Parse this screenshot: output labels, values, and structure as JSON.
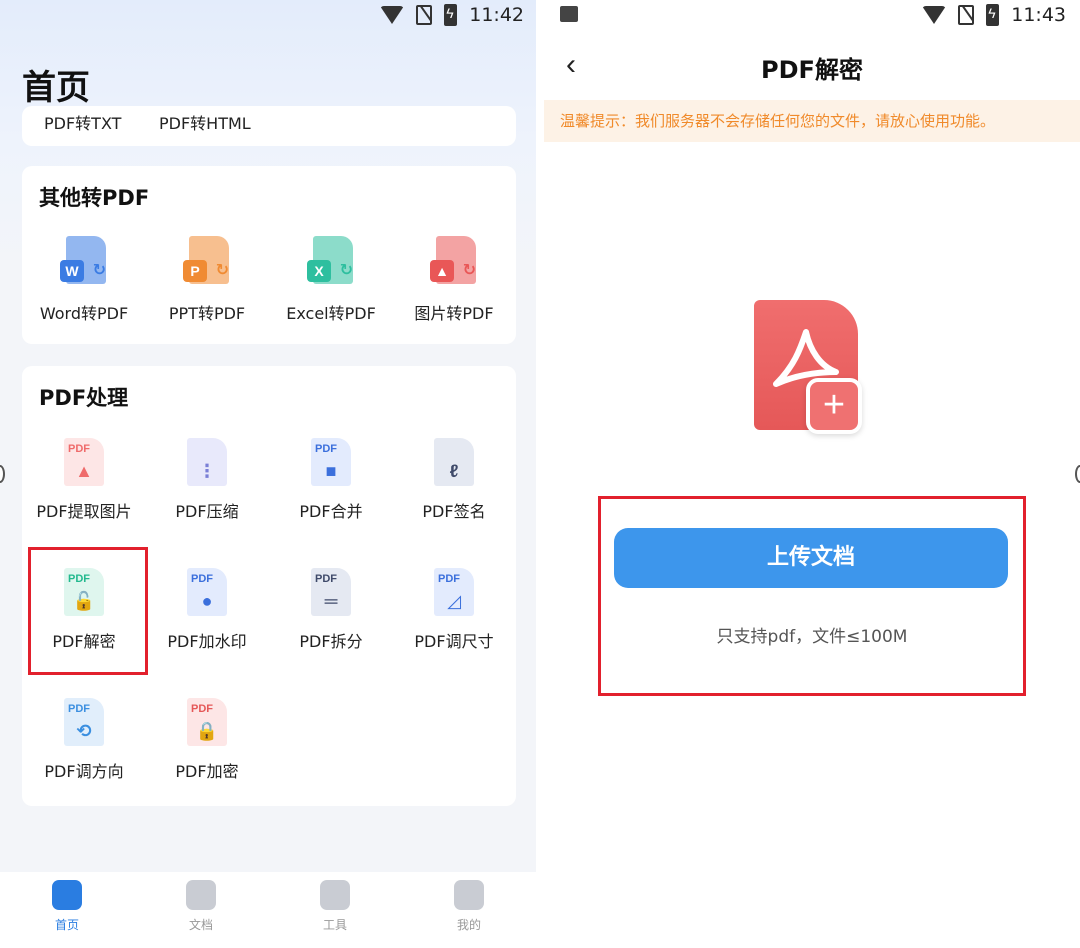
{
  "left": {
    "status": {
      "time": "11:42"
    },
    "page_title": "首页",
    "top_links": [
      "PDF转TXT",
      "PDF转HTML"
    ],
    "other_to_pdf": {
      "heading": "其他转PDF",
      "items": [
        {
          "label": "Word转PDF",
          "icon": "word-icon",
          "badge": "W",
          "color": "#3b7ce3"
        },
        {
          "label": "PPT转PDF",
          "icon": "ppt-icon",
          "badge": "P",
          "color": "#f08b33"
        },
        {
          "label": "Excel转PDF",
          "icon": "excel-icon",
          "badge": "X",
          "color": "#2ebf9f"
        },
        {
          "label": "图片转PDF",
          "icon": "image-icon",
          "badge": "▲",
          "color": "#e95757"
        }
      ]
    },
    "pdf_tools": {
      "heading": "PDF处理",
      "items": [
        {
          "label": "PDF提取图片",
          "icon": "extract-image-icon",
          "tag": "PDF",
          "glyph": "▲",
          "color": "#ef6b6b",
          "bg": "#fde6e6"
        },
        {
          "label": "PDF压缩",
          "icon": "compress-icon",
          "tag": "",
          "glyph": "⋮",
          "color": "#7a7fd6",
          "bg": "#e8e9fb"
        },
        {
          "label": "PDF合并",
          "icon": "merge-icon",
          "tag": "PDF",
          "glyph": "■",
          "color": "#3b6fdc",
          "bg": "#e3ebfd"
        },
        {
          "label": "PDF签名",
          "icon": "signature-icon",
          "tag": "",
          "glyph": "ℓ",
          "color": "#3f4a6a",
          "bg": "#e5e9f2"
        },
        {
          "label": "PDF解密",
          "icon": "decrypt-icon",
          "tag": "PDF",
          "glyph": "🔓",
          "color": "#22b98e",
          "bg": "#dff6ee"
        },
        {
          "label": "PDF加水印",
          "icon": "watermark-icon",
          "tag": "PDF",
          "glyph": "●",
          "color": "#3b6fdc",
          "bg": "#e3ebfd"
        },
        {
          "label": "PDF拆分",
          "icon": "split-icon",
          "tag": "PDF",
          "glyph": "═",
          "color": "#3f4a6a",
          "bg": "#e5e9f2"
        },
        {
          "label": "PDF调尺寸",
          "icon": "resize-icon",
          "tag": "PDF",
          "glyph": "◿",
          "color": "#3b6fdc",
          "bg": "#e3ebfd"
        },
        {
          "label": "PDF调方向",
          "icon": "rotate-icon",
          "tag": "PDF",
          "glyph": "⟲",
          "color": "#3b8fe0",
          "bg": "#e1eefb"
        },
        {
          "label": "PDF加密",
          "icon": "lock-icon",
          "tag": "PDF",
          "glyph": "🔒",
          "color": "#e55858",
          "bg": "#fde6e6"
        }
      ]
    },
    "tabs": [
      {
        "label": "首页",
        "icon": "home-icon",
        "active": true
      },
      {
        "label": "文档",
        "icon": "folder-icon",
        "active": false
      },
      {
        "label": "工具",
        "icon": "cube-icon",
        "active": false
      },
      {
        "label": "我的",
        "icon": "profile-icon",
        "active": false
      }
    ]
  },
  "right": {
    "status": {
      "time": "11:43"
    },
    "title": "PDF解密",
    "notice": "温馨提示：我们服务器不会存储任何您的文件，请放心使用功能。",
    "upload_button": "上传文档",
    "upload_hint": "只支持pdf，文件≤100M"
  }
}
